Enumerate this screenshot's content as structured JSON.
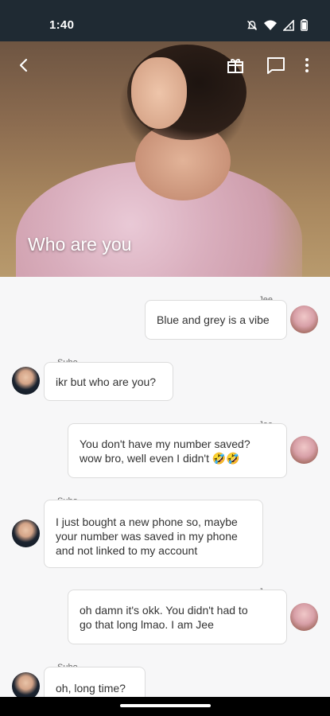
{
  "status_bar": {
    "time": "1:40",
    "icons": [
      "mute-icon",
      "wifi-icon",
      "signal-icon",
      "battery-icon"
    ]
  },
  "header": {
    "title": "Who are you",
    "actions": [
      "back-arrow-icon",
      "gift-icon",
      "chat-bubble-icon",
      "more-vertical-icon"
    ]
  },
  "messages": [
    {
      "sender": "Jee",
      "side": "right",
      "text": "Blue and grey is a vibe"
    },
    {
      "sender": "Suho",
      "side": "left",
      "text": "ikr but who are you?"
    },
    {
      "sender": "Jee",
      "side": "right",
      "text": "You don't have my number saved?\nwow bro, well even I didn't 🤣🤣"
    },
    {
      "sender": "Suho",
      "side": "left",
      "text": "I just bought a new phone so, maybe\nyour number was saved in my phone\nand not linked to my account"
    },
    {
      "sender": "Jee",
      "side": "right",
      "text": "oh damn it's okk. You didn't had to\ngo that long lmao. I am Jee"
    },
    {
      "sender": "Suho",
      "side": "left",
      "text": "oh, long time?"
    }
  ],
  "colors": {
    "status_bar": "#1f2a33",
    "background": "#f7f7f8",
    "bubble": "#ffffff",
    "bubble_border": "#dcdcdc"
  }
}
